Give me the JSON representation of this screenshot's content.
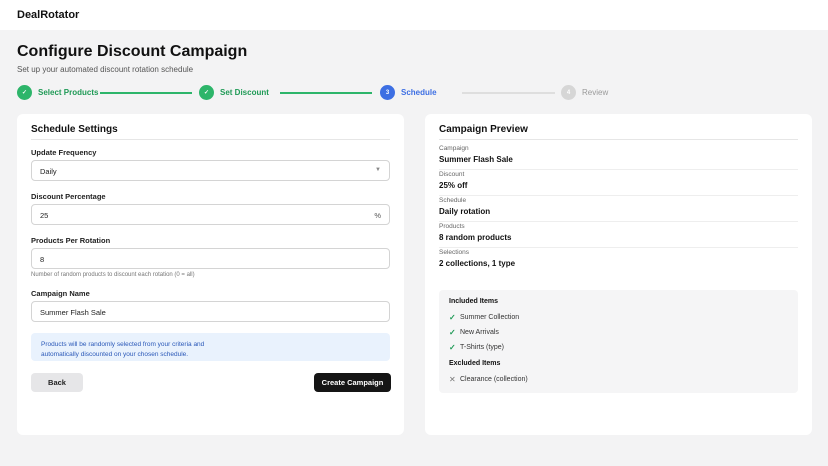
{
  "app": {
    "brand": "DealRotator"
  },
  "header": {
    "title": "Configure Discount Campaign",
    "subtitle": "Set up your automated discount rotation schedule"
  },
  "stepper": {
    "steps": [
      {
        "number": "✓",
        "label": "Select Products",
        "state": "done"
      },
      {
        "number": "✓",
        "label": "Set Discount",
        "state": "done"
      },
      {
        "number": "3",
        "label": "Schedule",
        "state": "active"
      },
      {
        "number": "4",
        "label": "Review",
        "state": "todo"
      }
    ]
  },
  "form": {
    "title": "Schedule Settings",
    "frequency": {
      "label": "Update Frequency",
      "value": "Daily"
    },
    "discount": {
      "label": "Discount Percentage",
      "value": "25",
      "suffix": "%"
    },
    "products": {
      "label": "Products Per Rotation",
      "value": "8",
      "help": "Number of random products to discount each rotation (0 = all)"
    },
    "name": {
      "label": "Campaign Name",
      "value": "Summer Flash Sale"
    },
    "info": "Products will be randomly selected from your criteria and automatically discounted on your chosen schedule.",
    "back_label": "Back",
    "create_label": "Create Campaign"
  },
  "preview": {
    "title": "Campaign Preview",
    "rows": [
      {
        "key": "Campaign",
        "value": "Summer Flash Sale"
      },
      {
        "key": "Discount",
        "value": "25% off"
      },
      {
        "key": "Schedule",
        "value": "Daily rotation"
      },
      {
        "key": "Products",
        "value": "8 random products"
      },
      {
        "key": "Selections",
        "value": "2 collections, 1 type"
      }
    ],
    "included_title": "Included Items",
    "included": [
      "Summer Collection",
      "New Arrivals",
      "T-Shirts (type)"
    ],
    "excluded_title": "Excluded Items",
    "excluded": [
      "Clearance (collection)"
    ]
  },
  "colors": {
    "done": "#2db56a",
    "active": "#3d6fe3",
    "todo": "#d6d6d6",
    "primary_button": "#151515",
    "info_bg": "#e9f2fd"
  }
}
